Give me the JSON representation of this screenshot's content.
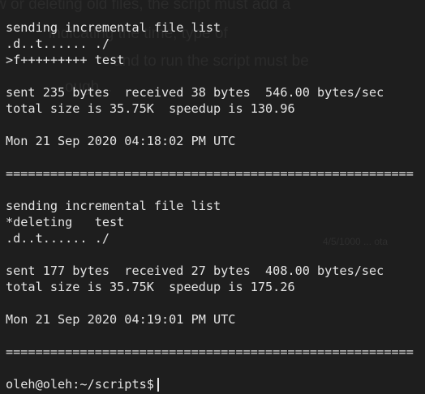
{
  "background_text": {
    "line1": "w or deleting old files, the script must add a",
    "line2": "indicating the time, type of",
    "line3": "and to run the script must be",
    "line4": "ough...",
    "line5": "4/5/1000 ... ota"
  },
  "terminal": {
    "lines": [
      "sending incremental file list",
      ".d..t...... ./",
      ">f+++++++++ test",
      "",
      "sent 235 bytes  received 38 bytes  546.00 bytes/sec",
      "total size is 35.75K  speedup is 130.96",
      "",
      "Mon 21 Sep 2020 04:18:02 PM UTC",
      "",
      "=======================================================",
      "",
      "sending incremental file list",
      "*deleting   test",
      ".d..t...... ./",
      "",
      "sent 177 bytes  received 27 bytes  408.00 bytes/sec",
      "total size is 35.75K  speedup is 175.26",
      "",
      "Mon 21 Sep 2020 04:19:01 PM UTC",
      "",
      "=======================================================",
      ""
    ],
    "prompt": "oleh@oleh:~/scripts$"
  },
  "colors": {
    "background": "#1e1e1e",
    "text": "#e4e4e4"
  }
}
